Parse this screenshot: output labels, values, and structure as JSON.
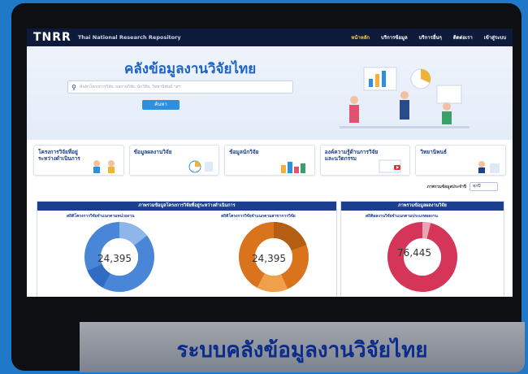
{
  "nav": {
    "logo": "TNRR",
    "logo_sub": "Thai National Research Repository",
    "links": [
      "หน้าหลัก",
      "บริการข้อมูล",
      "บริการอื่นๆ",
      "ติดต่อเรา",
      "เข้าสู่ระบบ"
    ]
  },
  "hero": {
    "title": "คลังข้อมูลงานวิจัยไทย",
    "search_placeholder": "ค้นหาโครงการวิจัย, ผลงานวิจัย, นักวิจัย, วิทยานิพนธ์ ฯลฯ",
    "search_button": "ค้นหา"
  },
  "categories": [
    "โครงการวิจัยที่อยู่ระหว่างดำเนินการ",
    "ข้อมูลผลงานวิจัย",
    "ข้อมูลนักวิจัย",
    "องค์ความรู้ด้านการวิจัยและนวัตกรรม",
    "วิทยานิพนธ์"
  ],
  "filter": {
    "label": "ภาพรวมข้อมูลประจำปี",
    "value": "ทุกปี"
  },
  "panel_left": {
    "header": "ภาพรวมข้อมูลโครงการวิจัยที่อยู่ระหว่างดำเนินการ",
    "chart1_title": "สถิติโครงการวิจัยจำแนกตามหน่วยงาน",
    "chart1_total": "24,395",
    "chart2_title": "สถิติโครงการวิจัยจำแนกตามสาขาการวิจัย",
    "chart2_total": "24,395"
  },
  "panel_right": {
    "header": "ภาพรวมข้อมูลผลงานวิจัย",
    "chart3_title": "สถิติผลงานวิจัยจำแนกตามประเภทผลงาน",
    "chart3_total": "76,445"
  },
  "banner": "ระบบคลังข้อมูลงานวิจัยไทย",
  "colors": {
    "bg": "#1f78c8",
    "nav": "#0d1a3a",
    "accent": "#1d63c6",
    "blue_donut": "#4a86d8",
    "orange_donut": "#d9731c",
    "red_donut": "#d43559"
  }
}
